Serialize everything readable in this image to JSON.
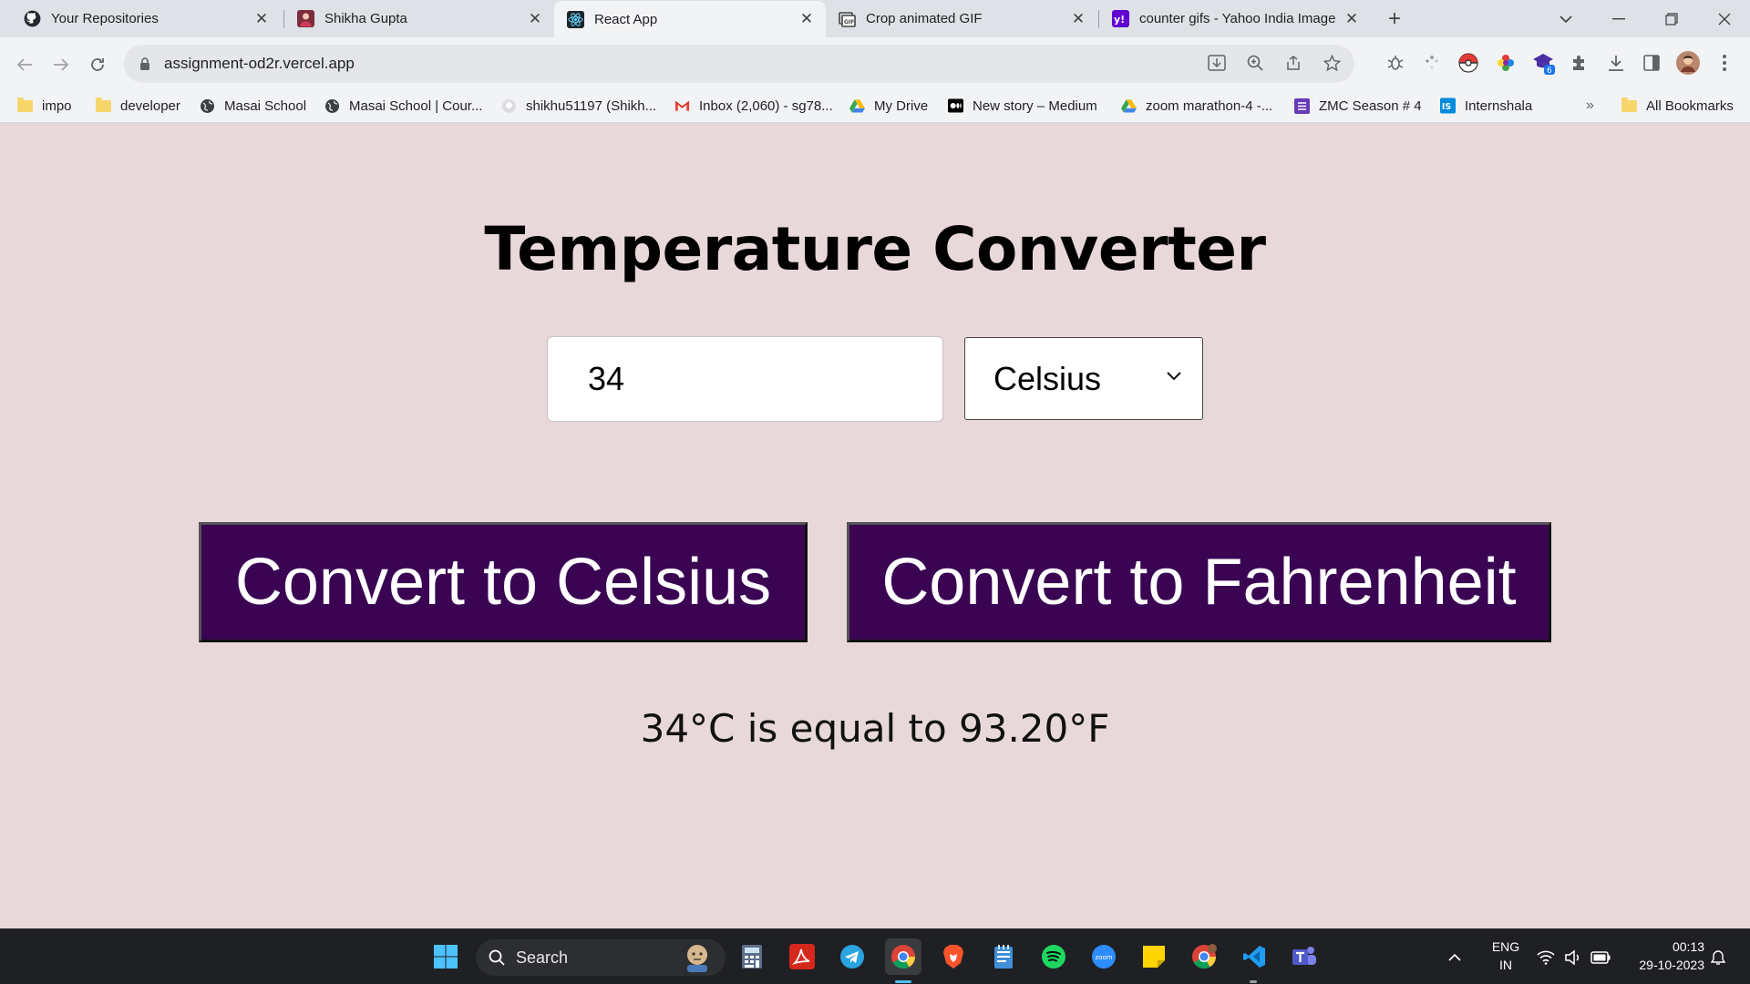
{
  "browser": {
    "tabs": [
      {
        "title": "Your Repositories",
        "icon": "github-icon"
      },
      {
        "title": "Shikha Gupta",
        "icon": "profile-icon"
      },
      {
        "title": "React App",
        "icon": "react-icon"
      },
      {
        "title": "Crop animated GIF",
        "icon": "gif-icon"
      },
      {
        "title": "counter gifs - Yahoo India Image",
        "icon": "yahoo-icon"
      }
    ],
    "url": "assignment-od2r.vercel.app",
    "bookmarks": [
      {
        "label": "impo",
        "icon": "folder-icon"
      },
      {
        "label": "developer",
        "icon": "folder-icon"
      },
      {
        "label": "Masai School",
        "icon": "globe-icon"
      },
      {
        "label": "Masai School | Cour...",
        "icon": "globe-icon"
      },
      {
        "label": "shikhu51197 (Shikh...",
        "icon": "github-icon"
      },
      {
        "label": "Inbox (2,060) - sg78...",
        "icon": "gmail-icon"
      },
      {
        "label": "My Drive",
        "icon": "drive-icon"
      },
      {
        "label": "New story – Medium",
        "icon": "medium-icon"
      },
      {
        "label": "zoom marathon-4 -...",
        "icon": "drive-icon"
      },
      {
        "label": "ZMC Season # 4",
        "icon": "forms-icon"
      },
      {
        "label": "Internshala",
        "icon": "internshala-icon"
      }
    ],
    "bookmarks_overflow": "»",
    "all_bookmarks": "All Bookmarks",
    "extension_badge": "6"
  },
  "app": {
    "title": "Temperature Converter",
    "input_value": "34",
    "unit_selected": "Celsius",
    "btn_celsius": "Convert to Celsius",
    "btn_fahrenheit": "Convert to Fahrenheit",
    "result": "34°C is equal to 93.20°F"
  },
  "taskbar": {
    "search_label": "Search",
    "lang_line1": "ENG",
    "lang_line2": "IN",
    "time": "00:13",
    "date": "29-10-2023"
  },
  "colors": {
    "page_bg": "#e9d8da",
    "button_bg": "#3a0453",
    "taskbar_bg": "#1f2024"
  }
}
